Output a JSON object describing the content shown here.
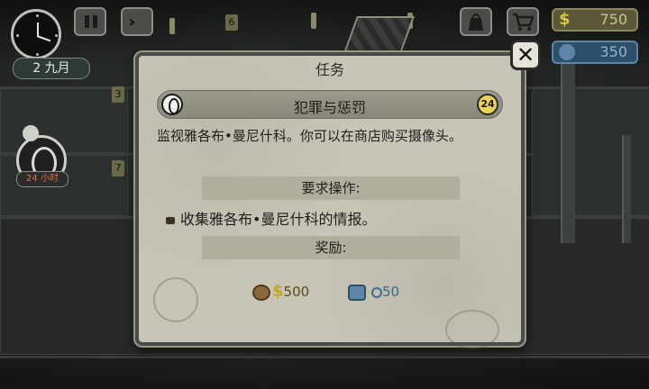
{
  "hud": {
    "date": "2 九月",
    "money": "750",
    "money_symbol": "$",
    "reputation": "350",
    "pause_icon": "pause-icon",
    "fast_forward_icon": "fast-forward-icon",
    "inventory_icon": "bag-icon",
    "shop_icon": "cart-icon",
    "door_numbers": [
      "3",
      "6",
      "7"
    ]
  },
  "side_task": {
    "timer": "24 小时"
  },
  "modal": {
    "title": "任务",
    "mission_name": "犯罪与惩罚",
    "mission_badge": "24",
    "description": "监视雅各布•曼尼什科。你可以在商店购买摄像头。",
    "requirements_header": "要求操作:",
    "requirement_item": "收集雅各布•曼尼什科的情报。",
    "reward_header": "奖励:",
    "reward_money": "500",
    "reward_money_symbol": "$",
    "reward_reputation": "50",
    "close_icon": "close-icon"
  },
  "colors": {
    "money_accent": "#d7c64a",
    "reputation_accent": "#5f86a8",
    "modal_bg": "#c8c4b6"
  }
}
